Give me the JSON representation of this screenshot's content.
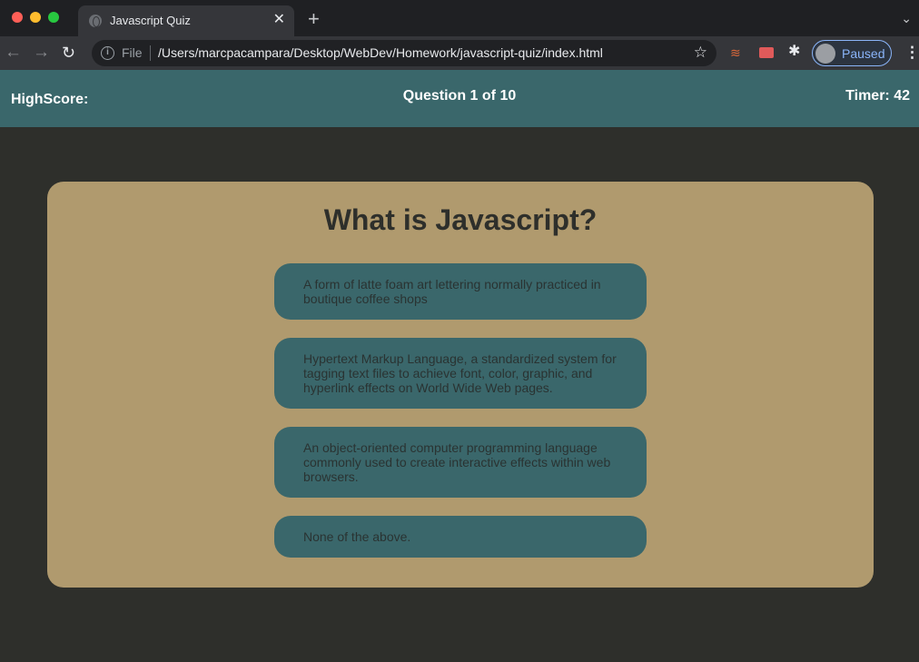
{
  "browser": {
    "tab_title": "Javascript Quiz",
    "tab_close": "✕",
    "new_tab": "+",
    "tab_menu": "⌄",
    "back": "←",
    "forward": "→",
    "reload": "↻",
    "info": "i",
    "url_scheme_label": "File",
    "url": "/Users/marcpacampara/Desktop/WebDev/Homework/javascript-quiz/index.html",
    "bookmark_star": "☆",
    "extensions_icon": "✱",
    "profile_status": "Paused",
    "menu": "⋮"
  },
  "header": {
    "highscore_label": "HighScore:",
    "question_count": "Question 1 of 10",
    "timer": "Timer: 42"
  },
  "quiz": {
    "question": "What is Javascript?",
    "answers": [
      "A form of latte foam art lettering normally practiced in boutique coffee shops",
      "Hypertext Markup Language, a standardized system for tagging text files to achieve font, color, graphic, and hyperlink effects on World Wide Web pages.",
      "An object-oriented computer programming language commonly used to create interactive effects within web browsers.",
      "None of the above."
    ]
  },
  "colors": {
    "header_bg": "#3a676b",
    "page_bg": "#2e2f2b",
    "card_bg": "#b09a6e",
    "answer_bg": "#3a676b"
  }
}
